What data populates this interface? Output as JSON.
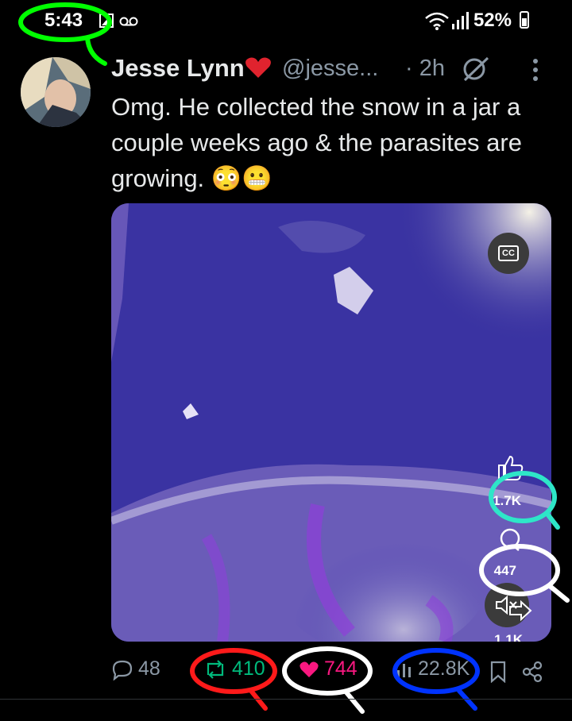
{
  "status_bar": {
    "time": "5:43",
    "battery": "52%",
    "icons": [
      "image-icon",
      "voicemail-icon",
      "wifi-icon",
      "signal-icon",
      "battery-icon"
    ]
  },
  "tweet": {
    "display_name": "Jesse Lynn",
    "name_emoji": "❤️",
    "handle": "@jesse...",
    "time": "· 2h",
    "text": "Omg. He collected the snow in a jar a couple weeks ago & the parasites are growing. 😳😬",
    "verified_icon": "grok-icon",
    "more_icon": "more-vert-icon"
  },
  "media": {
    "cc_label": "CC",
    "likes": "1.7K",
    "comments": "447",
    "shares": "1.1K",
    "background_color": "#3a34a0"
  },
  "actions": {
    "replies": "48",
    "reposts": "410",
    "likes": "744",
    "views": "22.8K",
    "colors": {
      "repost": "#00ba7c",
      "like": "#f91880",
      "default": "#8b98a5"
    }
  },
  "annotations": {
    "colors": {
      "time": "#00ff00",
      "reposts": "#ff1a1a",
      "likes": "#ffffff",
      "views": "#0033ff",
      "video_likes": "#2ee6c8",
      "video_comments": "#ffffff"
    }
  }
}
